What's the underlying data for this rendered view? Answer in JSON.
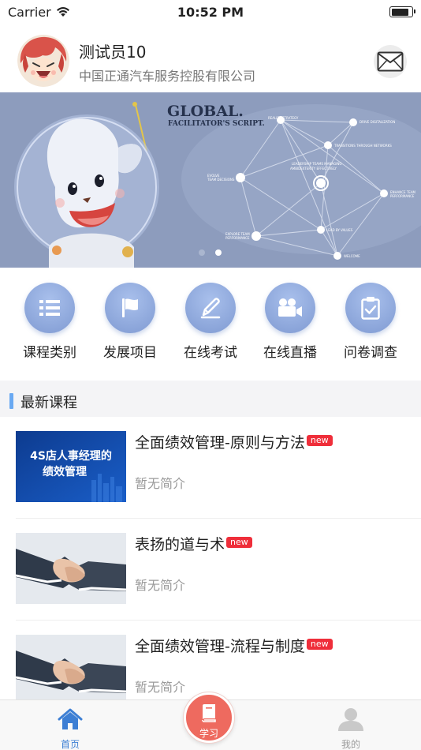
{
  "status_bar": {
    "carrier": "Carrier",
    "time": "10:52 PM",
    "battery_level": 0.85
  },
  "profile": {
    "name": "测试员10",
    "company": "中国正通汽车服务控股有限公司",
    "mail_icon": "envelope-icon"
  },
  "banner": {
    "headline": "GLOBAL.",
    "subheadline": "FACILITATOR'S SCRIPT.",
    "network_labels": [
      "REALIZE STRATEGY",
      "DRIVE DIGITALIZATION",
      "TRANSITIONS THROUGH NETWORKS",
      "LEADERSHIP TEAMS MANAGING",
      "AMBIDEXTERITY EFFECTIVELY",
      "EVOLVE",
      "TEAM DECISIONS",
      "ENHANCE TEAM",
      "PERFORMANCE",
      "EXPLORE TEAM",
      "PERFORMANCE",
      "LEAD BY VALUES",
      "WELCOME"
    ],
    "page_count": 2,
    "active_page": 2
  },
  "shortcuts": [
    {
      "label": "课程类别",
      "icon": "list-icon"
    },
    {
      "label": "发展项目",
      "icon": "flag-icon"
    },
    {
      "label": "在线考试",
      "icon": "pencil-icon"
    },
    {
      "label": "在线直播",
      "icon": "video-camera-icon"
    },
    {
      "label": "问卷调查",
      "icon": "clipboard-check-icon"
    }
  ],
  "section": {
    "title": "最新课程"
  },
  "courses": [
    {
      "title": "全面绩效管理-原则与方法",
      "badge": "new",
      "desc": "暂无简介",
      "thumb_text": [
        "4S店人事经理的",
        "绩效管理"
      ]
    },
    {
      "title": "表扬的道与术",
      "badge": "new",
      "desc": "暂无简介"
    },
    {
      "title": "全面绩效管理-流程与制度",
      "badge": "new",
      "desc": "暂无简介"
    }
  ],
  "tabbar": {
    "home": "首页",
    "study": "学习",
    "mine": "我的",
    "colors": {
      "active": "#3d7fd4",
      "inactive": "#9a9a9a",
      "study": "#ee6a5f"
    }
  }
}
